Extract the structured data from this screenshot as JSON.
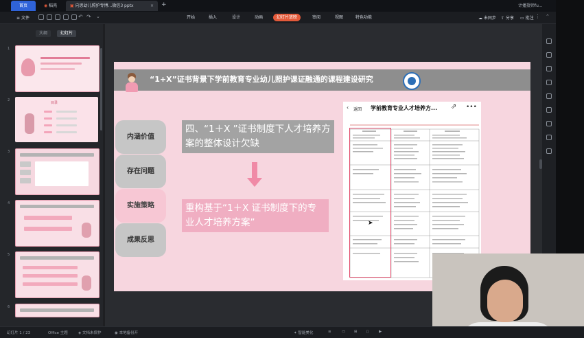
{
  "titlebar": {
    "tabs": [
      "首页",
      "稻壳",
      "向思幼儿照护专博...微信3 pptx"
    ],
    "new_tab": "+",
    "account": "计播授师fu..."
  },
  "menubar": {
    "file": "文件",
    "items": [
      "开始",
      "插入",
      "设计",
      "动画",
      "幻灯片放映",
      "审阅",
      "视图",
      "特色功能"
    ],
    "active_index": 4,
    "right": [
      "未同步",
      "分享",
      "批注"
    ]
  },
  "left_panel": {
    "tabs": [
      "大纲",
      "幻灯片"
    ],
    "slide_numbers": [
      "1",
      "2",
      "3",
      "4",
      "5",
      "6"
    ],
    "thumb2_title": "目录"
  },
  "slide": {
    "title": "“1+X”证书背景下学前教育专业幼儿照护课证融通的课程建设研究",
    "nav": [
      "内涵价值",
      "存在问题",
      "实施策略",
      "成果反思"
    ],
    "selected_nav_index": 2,
    "box1_text": "四、“1＋X ”证书制度下人才培养方案的整体设计欠缺",
    "box2_text": "重构基于“1＋X 证书制度下的专业人才培养方案”",
    "phone": {
      "back_label": "返回",
      "doc_title": "学前教育专业人才培养方...",
      "more": "•••"
    }
  },
  "status": {
    "slide_counter": "幻灯片 1 / 23",
    "theme": "Office 主题",
    "doc_protect": "文档未保护",
    "local_backup": "本地备份开",
    "smart_beautify": "智能美化"
  }
}
